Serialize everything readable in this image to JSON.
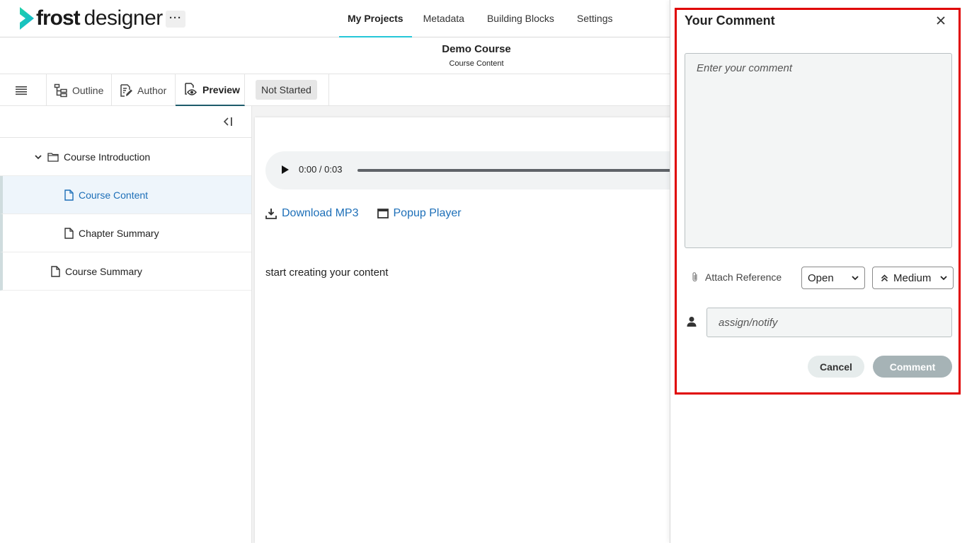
{
  "app": {
    "logo_word_bold": "frost",
    "logo_word_light": "designer",
    "more_label": "···"
  },
  "topnav": {
    "items": [
      {
        "label": "My Projects",
        "active": true
      },
      {
        "label": "Metadata"
      },
      {
        "label": "Building Blocks"
      },
      {
        "label": "Settings"
      }
    ]
  },
  "course": {
    "title": "Demo Course",
    "subtitle": "Course Content"
  },
  "toolbar": {
    "outline_label": "Outline",
    "author_label": "Author",
    "preview_label": "Preview",
    "status_label": "Not Started"
  },
  "tree": {
    "items": [
      {
        "label": "Course Introduction",
        "type": "folder",
        "expanded": true
      },
      {
        "label": "Course Content",
        "type": "page",
        "selected": true
      },
      {
        "label": "Chapter Summary",
        "type": "page"
      },
      {
        "label": "Course Summary",
        "type": "page"
      }
    ]
  },
  "content": {
    "audio_time": "0:00 / 0:03",
    "download_label": "Download MP3",
    "popup_label": "Popup Player",
    "body_text": "start creating your content"
  },
  "comment": {
    "title": "Your Comment",
    "placeholder": "Enter your comment",
    "attach_label": "Attach Reference",
    "status_value": "Open",
    "priority_value": "Medium",
    "assign_placeholder": "assign/notify",
    "cancel_label": "Cancel",
    "submit_label": "Comment"
  },
  "colors": {
    "accent": "#25c7d8",
    "link": "#1d6fb8",
    "highlight": "#e00000",
    "comment_button": "#a6b3b6"
  }
}
